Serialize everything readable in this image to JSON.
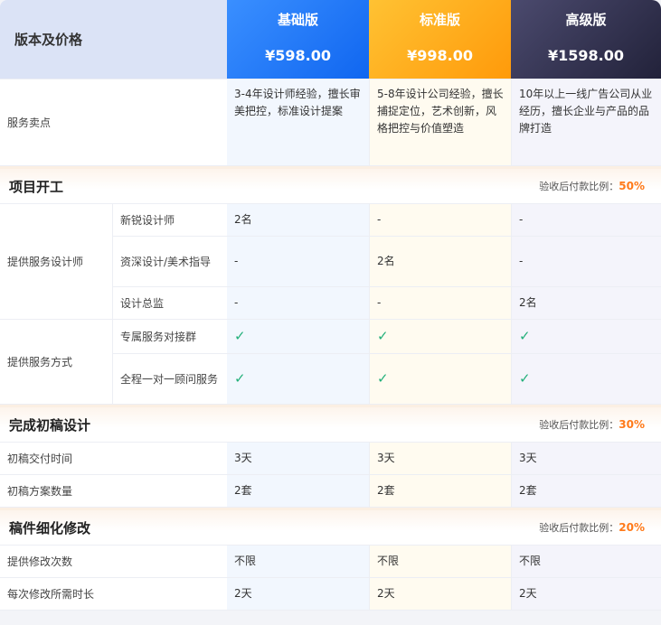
{
  "header": {
    "title": "版本及价格",
    "plans": [
      {
        "name": "基础版",
        "price": "¥598.00"
      },
      {
        "name": "标准版",
        "price": "¥998.00"
      },
      {
        "name": "高级版",
        "price": "¥1598.00"
      }
    ]
  },
  "selling": {
    "label": "服务卖点",
    "values": [
      "3-4年设计师经验，擅长审美把控，标准设计提案",
      "5-8年设计公司经验，擅长捕捉定位，艺术创新，风格把控与价值塑造",
      "10年以上一线广告公司从业经历，擅长企业与产品的品牌打造"
    ]
  },
  "sections": {
    "kickoff": {
      "title": "项目开工",
      "ratio_label": "验收后付款比例：",
      "ratio": "50%"
    },
    "draft": {
      "title": "完成初稿设计",
      "ratio_label": "验收后付款比例：",
      "ratio": "30%"
    },
    "revise": {
      "title": "稿件细化修改",
      "ratio_label": "验收后付款比例：",
      "ratio": "20%"
    }
  },
  "designers": {
    "label": "提供服务设计师",
    "rows": [
      {
        "sub": "新锐设计师",
        "values": [
          "2名",
          "-",
          "-"
        ]
      },
      {
        "sub": "资深设计/美术指导",
        "values": [
          "-",
          "2名",
          "-"
        ]
      },
      {
        "sub": "设计总监",
        "values": [
          "-",
          "-",
          "2名"
        ]
      }
    ]
  },
  "service_mode": {
    "label": "提供服务方式",
    "rows": [
      {
        "sub": "专属服务对接群",
        "values": [
          "✓",
          "✓",
          "✓"
        ]
      },
      {
        "sub": "全程一对一顾问服务",
        "values": [
          "✓",
          "✓",
          "✓"
        ]
      }
    ]
  },
  "draft_rows": [
    {
      "label": "初稿交付时间",
      "values": [
        "3天",
        "3天",
        "3天"
      ]
    },
    {
      "label": "初稿方案数量",
      "values": [
        "2套",
        "2套",
        "2套"
      ]
    }
  ],
  "revise_rows": [
    {
      "label": "提供修改次数",
      "values": [
        "不限",
        "不限",
        "不限"
      ]
    },
    {
      "label": "每次修改所需时长",
      "values": [
        "2天",
        "2天",
        "2天"
      ]
    }
  ],
  "colors": {
    "check": "#23b07a",
    "ratio": "#ff7a1a",
    "basic": "#1a73f5",
    "standard": "#ffab1f",
    "advanced": "#2e2d47"
  },
  "icons": {
    "check": "check-icon"
  }
}
